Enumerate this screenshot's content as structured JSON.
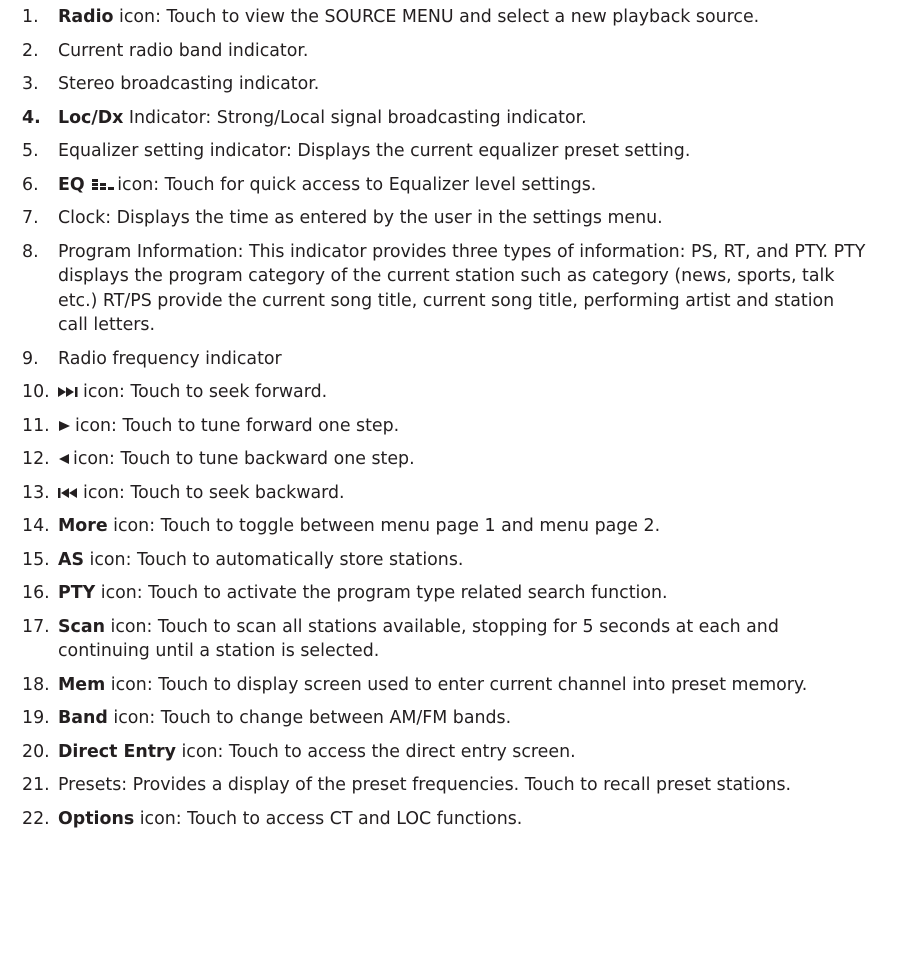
{
  "items": [
    {
      "num": "1.",
      "kw": "Radio",
      "text": " icon: Touch to view the SOURCE MENU and select a new playback source."
    },
    {
      "num": "2.",
      "text": "Current radio band indicator."
    },
    {
      "num": "3.",
      "text": "Stereo broadcasting indicator."
    },
    {
      "num": "4.",
      "kw": "Loc/Dx",
      "text": " Indicator: Strong/Local signal broadcasting indicator."
    },
    {
      "num": "5.",
      "text": "Equalizer setting indicator: Displays the current equalizer preset setting."
    },
    {
      "num": "6.",
      "kw": "EQ",
      "icon": "equalizer-icon",
      "text": "icon: Touch for quick access to Equalizer level settings."
    },
    {
      "num": "7.",
      "text": "Clock: Displays the time as entered by the user in the settings menu."
    },
    {
      "num": "8.",
      "text": "Program Information: This indicator provides three types of information: PS, RT, and PTY. PTY displays the program category of the current station such as category (news, sports, talk etc.) RT/PS provide the current song title, current song title, performing artist and station call letters."
    },
    {
      "num": "9.",
      "text": "Radio frequency indicator"
    },
    {
      "num": "10.",
      "icon": "seek-forward-icon",
      "text": "icon: Touch to seek forward."
    },
    {
      "num": "11.",
      "icon": "tune-forward-icon",
      "text": "icon: Touch to tune forward one step."
    },
    {
      "num": "12.",
      "icon": "tune-backward-icon",
      "text": "icon: Touch to tune backward one step."
    },
    {
      "num": "13.",
      "icon": "seek-backward-icon",
      "text": "icon: Touch to seek backward."
    },
    {
      "num": "14.",
      "kw": "More",
      "text": " icon: Touch to toggle between menu page 1 and menu page 2."
    },
    {
      "num": "15.",
      "kw": "AS",
      "text": " icon: Touch to automatically store stations."
    },
    {
      "num": "16.",
      "kw": "PTY",
      "text": " icon: Touch to activate the program type related search function."
    },
    {
      "num": "17.",
      "kw": "Scan",
      "text": " icon: Touch to scan all stations available, stopping for 5 seconds at each and continuing until a station is selected."
    },
    {
      "num": "18.",
      "kw": "Mem",
      "text": " icon: Touch to display screen used to enter current channel into preset memory."
    },
    {
      "num": "19.",
      "kw": "Band",
      "text": " icon: Touch to change between AM/FM bands."
    },
    {
      "num": "20.",
      "kw": "Direct Entry",
      "text": " icon: Touch to access the direct entry screen."
    },
    {
      "num": "21.",
      "text": "Presets: Provides a display of the preset frequencies. Touch to recall preset stations."
    },
    {
      "num": "22.",
      "kw": "Options",
      "text": " icon: Touch to access CT and LOC functions."
    }
  ]
}
